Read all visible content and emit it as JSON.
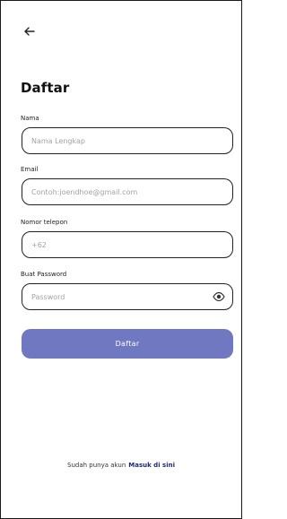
{
  "header": {
    "back_icon": "arrow-left-icon"
  },
  "title": "Daftar",
  "form": {
    "name": {
      "label": "Nama",
      "placeholder": "Nama Lengkap",
      "value": ""
    },
    "email": {
      "label": "Email",
      "placeholder": "Contoh:joendhoe@gmail.com",
      "value": ""
    },
    "phone": {
      "label": "Nomor telepon",
      "placeholder": "+62",
      "value": ""
    },
    "password": {
      "label": "Buat Password",
      "placeholder": "Password",
      "value": "",
      "toggle_icon": "eye-icon"
    },
    "submit_label": "Daftar"
  },
  "footer": {
    "text": "Sudah punya akun",
    "link_label": "Masuk di sini"
  },
  "colors": {
    "primary": "#7078c1",
    "link": "#1e2a78",
    "border": "#222222",
    "placeholder": "#a3a3a3"
  }
}
